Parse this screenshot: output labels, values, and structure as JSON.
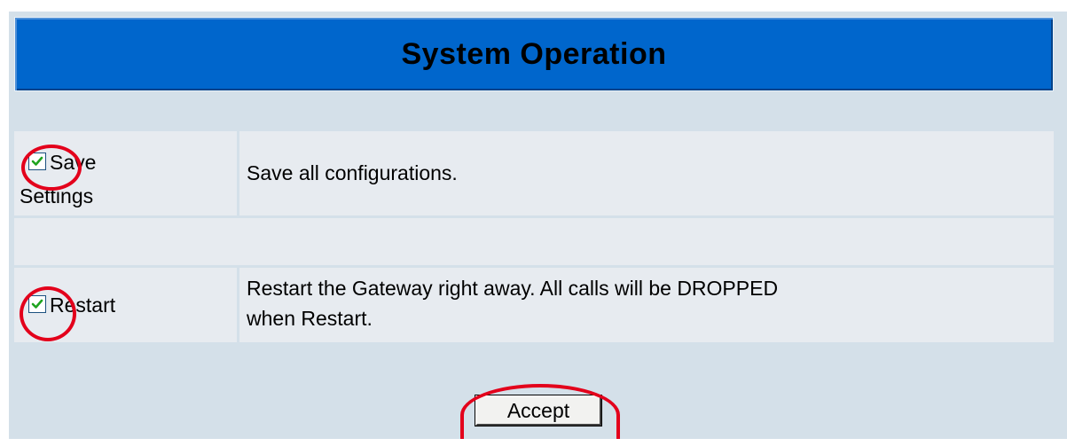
{
  "header": {
    "title": "System Operation"
  },
  "rows": [
    {
      "label_line1": "Save",
      "label_line2": "Settings",
      "description": "Save all configurations.",
      "checked": true
    },
    {
      "label": "Restart",
      "description_line1": "Restart the Gateway right away. All calls will be DROPPED",
      "description_line2": "when Restart.",
      "checked": true
    }
  ],
  "actions": {
    "accept_label": "Accept"
  },
  "colors": {
    "header_bg": "#0066cc",
    "panel_bg": "#d4e0e9",
    "row_bg": "#e7ebf0",
    "annotation_red": "#e3001b",
    "check_green": "#1fa31f"
  },
  "icons": {
    "checkbox_mark": "check-icon"
  }
}
